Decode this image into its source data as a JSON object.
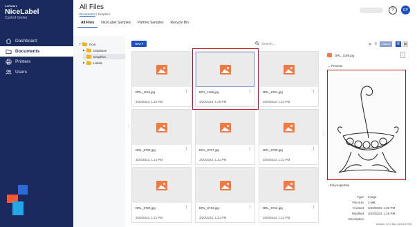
{
  "brand": {
    "company": "Loftware",
    "product": "NiceLabel",
    "subtitle": "Control Center"
  },
  "sidebar": {
    "items": [
      {
        "label": "Dashboard",
        "icon": "home-icon"
      },
      {
        "label": "Documents",
        "icon": "folder-icon",
        "active": true
      },
      {
        "label": "Printers",
        "icon": "printer-icon"
      },
      {
        "label": "Users",
        "icon": "users-icon"
      }
    ]
  },
  "header": {
    "title": "All Files",
    "breadcrumb": {
      "root": "Documents",
      "separator": "/",
      "current": "Graphics"
    },
    "tabs": [
      "All Files",
      "NiceLabel Samples",
      "Partner Samples",
      "Recycle Bin"
    ],
    "user_initials": "EP",
    "help": "?"
  },
  "tree": {
    "items": [
      {
        "label": "Root",
        "level": 0
      },
      {
        "label": "Database",
        "level": 1
      },
      {
        "label": "Graphics",
        "level": 1,
        "selected": true
      },
      {
        "label": "Labels",
        "level": 1
      }
    ]
  },
  "toolbar": {
    "new_label": "New",
    "search_placeholder": "Search...",
    "collapse_label": "Collapse"
  },
  "files": [
    {
      "name": "DRL_1164.jpg",
      "date": "3/20/2023, 1:22 PM"
    },
    {
      "name": "DRL_1166.jpg",
      "date": "3/20/2023, 1:25 PM",
      "selected": true
    },
    {
      "name": "DRL_6701.jpg",
      "date": "3/20/2023, 1:21 PM"
    },
    {
      "name": "DRL_6702.jpg",
      "date": "3/20/2023, 1:21 PM"
    },
    {
      "name": "DRL_6707.jpg",
      "date": "3/20/2023, 1:21 PM"
    },
    {
      "name": "DRL_6709.jpg",
      "date": "3/20/2023, 1:21 PM"
    },
    {
      "name": "DRL_6720.jpg",
      "date": "3/20/2023, 1:21 PM"
    },
    {
      "name": "DRL_6723.jpg",
      "date": "3/20/2023, 1:21 PM"
    },
    {
      "name": "DRL_6744.jpg",
      "date": "3/20/2023, 1:21 PM"
    }
  ],
  "panel": {
    "file_name": "DRL_1166.jpg",
    "preview_label": "Preview",
    "properties_label": "File properties",
    "properties": [
      {
        "key": "Type",
        "value": "Image"
      },
      {
        "key": "File size",
        "value": "2 MB"
      },
      {
        "key": "Created",
        "value": "3/20/2023, 1:25 PM"
      },
      {
        "key": "Modified",
        "value": "3/20/2023, 1:25 PM"
      },
      {
        "key": "Description",
        "value": ""
      }
    ]
  },
  "version": "Version: 10.3 Dev (3.3.0.6729)",
  "colors": {
    "sidebar": "#1b2a5e",
    "accent": "#1f4fbf",
    "highlight": "#c4141e",
    "image_icon": "#f27a42"
  }
}
